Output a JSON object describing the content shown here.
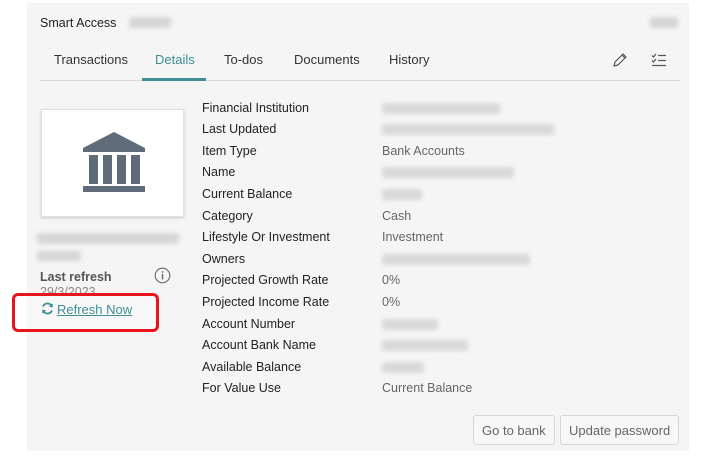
{
  "header": {
    "title": "Smart Access"
  },
  "tabs": [
    {
      "label": "Transactions"
    },
    {
      "label": "Details",
      "active": true
    },
    {
      "label": "To-dos"
    },
    {
      "label": "Documents"
    },
    {
      "label": "History"
    }
  ],
  "toolbar_icons": [
    "pencil-icon",
    "checklist-icon"
  ],
  "sidebar": {
    "last_refresh_label": "Last refresh",
    "last_refresh_date": "29/3/2023",
    "refresh_label": "Refresh Now",
    "info_icon": "info-icon"
  },
  "details": {
    "labels": [
      "Financial Institution",
      "Last Updated",
      "Item Type",
      "Name",
      "Current Balance",
      "Category",
      "Lifestyle Or Investment",
      "Owners",
      "Projected Growth Rate",
      "Projected Income Rate",
      "Account Number",
      "Account Bank Name",
      "Available Balance",
      "For Value Use"
    ],
    "values": {
      "item_type": "Bank Accounts",
      "category": "Cash",
      "lifestyle_or_investment": "Investment",
      "projected_growth_rate": "0%",
      "projected_income_rate": "0%",
      "for_value_use": "Current Balance"
    }
  },
  "buttons": {
    "go_to_bank": "Go to bank",
    "update_password": "Update password"
  },
  "colors": {
    "accent": "#3f8e95",
    "highlight": "#e8141e",
    "bank_icon": "#5f6b78"
  }
}
